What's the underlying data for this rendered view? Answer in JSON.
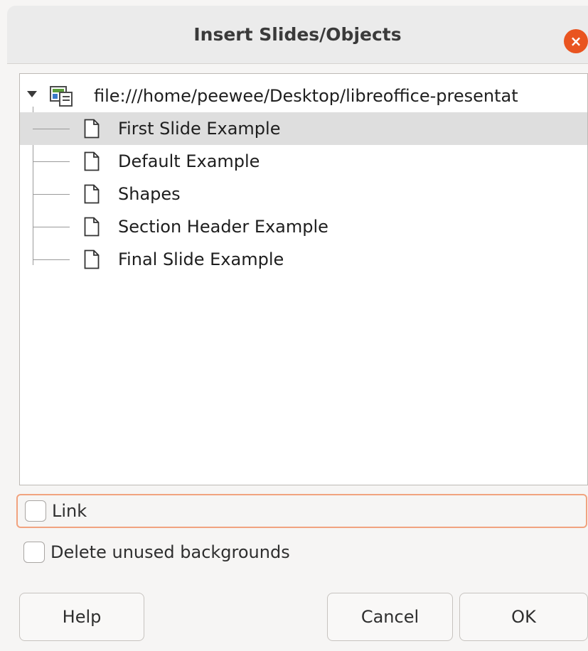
{
  "dialog": {
    "title": "Insert Slides/Objects",
    "close_symbol": "×",
    "accent_color": "#e95420"
  },
  "tree": {
    "root": {
      "label": "file:///home/peewee/Desktop/libreoffice-presentat",
      "icon": "presentation-icon",
      "expanded": true
    },
    "items": [
      {
        "label": "First Slide Example",
        "icon": "page-icon",
        "selected": true
      },
      {
        "label": "Default Example",
        "icon": "page-icon",
        "selected": false
      },
      {
        "label": "Shapes",
        "icon": "page-icon",
        "selected": false
      },
      {
        "label": "Section Header Example",
        "icon": "page-icon",
        "selected": false
      },
      {
        "label": "Final Slide Example",
        "icon": "page-icon",
        "selected": false
      }
    ]
  },
  "options": {
    "link_label": "Link",
    "link_checked": false,
    "delete_label": "Delete unused backgrounds",
    "delete_checked": false
  },
  "buttons": {
    "help": "Help",
    "cancel": "Cancel",
    "ok": "OK"
  }
}
